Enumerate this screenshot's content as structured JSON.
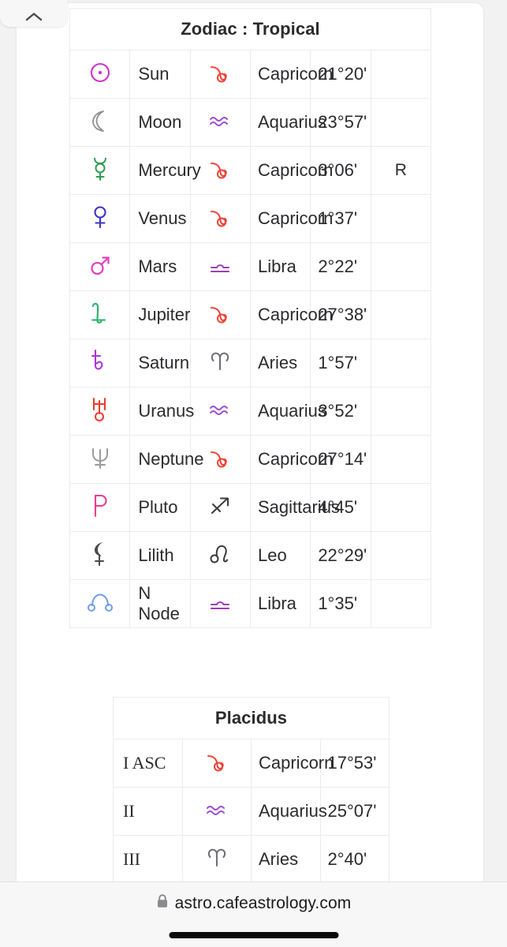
{
  "browser": {
    "tab_pill_icon": "chevron-up-icon",
    "url": "astro.cafeastrology.com",
    "lock_icon": "lock-icon",
    "home_indicator": "home-indicator"
  },
  "zodiac_table": {
    "caption": "Zodiac : Tropical",
    "columns": [
      "planet-glyph",
      "planet",
      "sign-glyph",
      "sign",
      "degree",
      "retrograde"
    ],
    "rows": [
      {
        "glyph": "sun-glyph",
        "planet": "Sun",
        "sign_glyph": "capricorn-glyph",
        "sign": "Capricorn",
        "degree": "21°20'",
        "retro": ""
      },
      {
        "glyph": "moon-glyph",
        "planet": "Moon",
        "sign_glyph": "aquarius-glyph",
        "sign": "Aquarius",
        "degree": "23°57'",
        "retro": ""
      },
      {
        "glyph": "mercury-glyph",
        "planet": "Mercury",
        "sign_glyph": "capricorn-glyph",
        "sign": "Capricorn",
        "degree": "3°06'",
        "retro": "R"
      },
      {
        "glyph": "venus-glyph",
        "planet": "Venus",
        "sign_glyph": "capricorn-glyph",
        "sign": "Capricorn",
        "degree": "1°37'",
        "retro": ""
      },
      {
        "glyph": "mars-glyph",
        "planet": "Mars",
        "sign_glyph": "libra-glyph",
        "sign": "Libra",
        "degree": "2°22'",
        "retro": ""
      },
      {
        "glyph": "jupiter-glyph",
        "planet": "Jupiter",
        "sign_glyph": "capricorn-glyph",
        "sign": "Capricorn",
        "degree": "27°38'",
        "retro": ""
      },
      {
        "glyph": "saturn-glyph",
        "planet": "Saturn",
        "sign_glyph": "aries-glyph",
        "sign": "Aries",
        "degree": "1°57'",
        "retro": ""
      },
      {
        "glyph": "uranus-glyph",
        "planet": "Uranus",
        "sign_glyph": "aquarius-glyph",
        "sign": "Aquarius",
        "degree": "3°52'",
        "retro": ""
      },
      {
        "glyph": "neptune-glyph",
        "planet": "Neptune",
        "sign_glyph": "capricorn-glyph",
        "sign": "Capricorn",
        "degree": "27°14'",
        "retro": ""
      },
      {
        "glyph": "pluto-glyph",
        "planet": "Pluto",
        "sign_glyph": "sagittarius-glyph",
        "sign": "Sagittarius",
        "degree": "4°45'",
        "retro": ""
      },
      {
        "glyph": "lilith-glyph",
        "planet": "Lilith",
        "sign_glyph": "leo-glyph",
        "sign": "Leo",
        "degree": "22°29'",
        "retro": ""
      },
      {
        "glyph": "nnode-glyph",
        "planet": "N Node",
        "sign_glyph": "libra-glyph",
        "sign": "Libra",
        "degree": "1°35'",
        "retro": ""
      }
    ]
  },
  "placidus_table": {
    "caption": "Placidus",
    "columns": [
      "house",
      "sign-glyph",
      "sign",
      "degree"
    ],
    "rows": [
      {
        "house": "I ASC",
        "sign_glyph": "capricorn-glyph",
        "sign": "Capricorn",
        "degree": "17°53'"
      },
      {
        "house": "II",
        "sign_glyph": "aquarius-glyph",
        "sign": "Aquarius",
        "degree": "25°07'"
      },
      {
        "house": "III",
        "sign_glyph": "aries-glyph",
        "sign": "Aries",
        "degree": "2°40'"
      }
    ]
  },
  "colors": {
    "sun": "#cc33cc",
    "moon": "#8e8e93",
    "mercury": "#2e9e4f",
    "venus": "#3a34c6",
    "mars": "#e33fc0",
    "jupiter": "#27b26a",
    "saturn": "#a935d8",
    "uranus": "#ef3b2c",
    "neptune": "#9a9aa0",
    "pluto": "#ef3b8e",
    "lilith": "#4a4a4f",
    "nnode": "#6e9fe8",
    "capricorn": "#ef4136",
    "aquarius": "#9b4fd0",
    "libra": "#9b3fb5",
    "aries": "#6e6e73",
    "sagittarius": "#3a3a3e",
    "leo": "#3a3a3e",
    "text": "#2b2b2e"
  }
}
